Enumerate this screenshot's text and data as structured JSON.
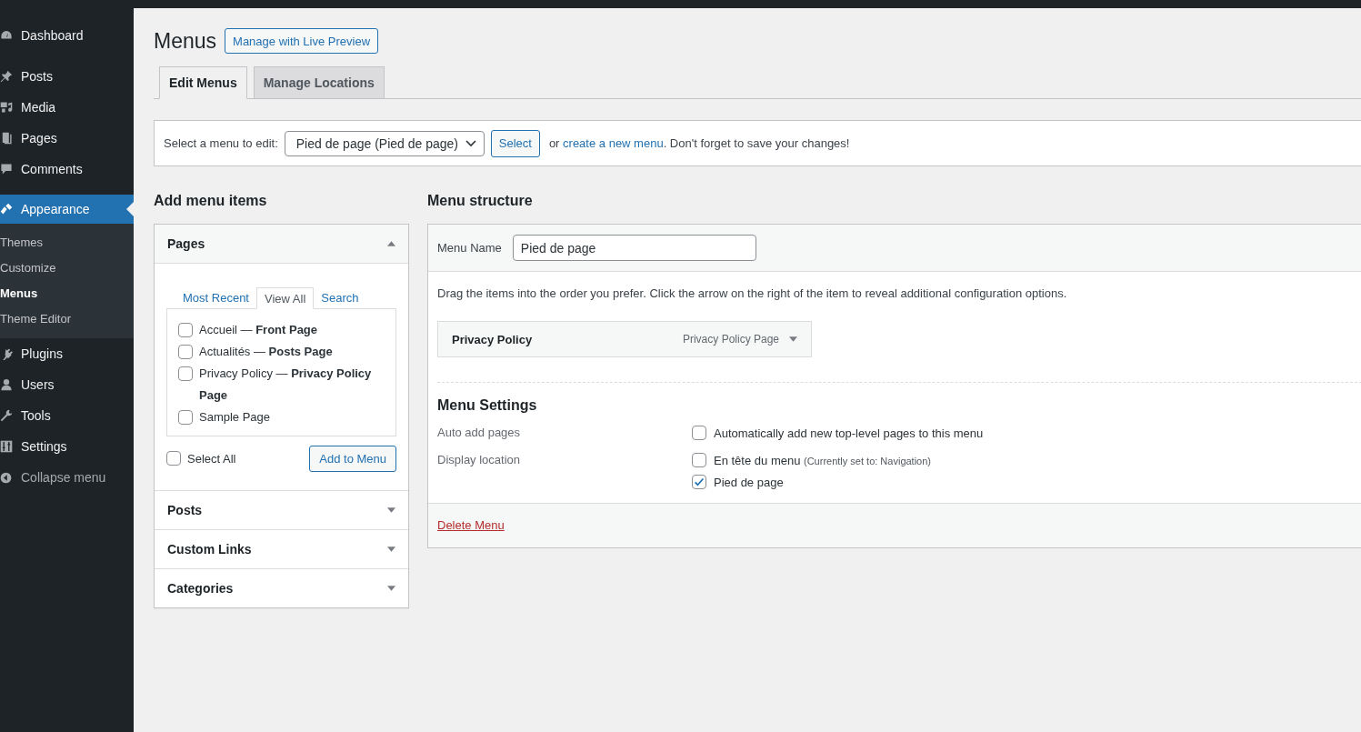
{
  "sidebar": {
    "groups": [
      [
        {
          "label": "Dashboard",
          "selected": false
        }
      ],
      [
        {
          "label": "Posts",
          "selected": false
        },
        {
          "label": "Media",
          "selected": false
        },
        {
          "label": "Pages",
          "selected": false
        },
        {
          "label": "Comments",
          "selected": false
        }
      ],
      [
        {
          "label": "Appearance",
          "selected": true,
          "children": [
            {
              "label": "Themes",
              "selected": false
            },
            {
              "label": "Customize",
              "selected": false
            },
            {
              "label": "Menus",
              "selected": true
            },
            {
              "label": "Theme Editor",
              "selected": false
            }
          ]
        },
        {
          "label": "Plugins",
          "selected": false
        },
        {
          "label": "Users",
          "selected": false
        },
        {
          "label": "Tools",
          "selected": false
        },
        {
          "label": "Settings",
          "selected": false
        }
      ]
    ],
    "collapse_label": "Collapse menu"
  },
  "page": {
    "title": "Menus",
    "live_preview_button": "Manage with Live Preview",
    "tabs": [
      {
        "label": "Edit Menus",
        "selected": true
      },
      {
        "label": "Manage Locations",
        "selected": false
      }
    ]
  },
  "menu_select": {
    "label": "Select a menu to edit:",
    "value": "Pied de page (Pied de page)",
    "button": "Select",
    "hint_before": "or ",
    "hint_link": "create a new menu",
    "hint_after": ". Don't forget to save your changes!"
  },
  "add_items": {
    "heading": "Add menu items",
    "sections": [
      {
        "title": "Pages",
        "expanded": true,
        "tabs": [
          {
            "label": "Most Recent",
            "selected": false
          },
          {
            "label": "View All",
            "selected": true
          },
          {
            "label": "Search",
            "selected": false
          }
        ],
        "items": [
          {
            "label": "Accueil — **Front Page**",
            "checked": false
          },
          {
            "label": "Actualités — **Posts Page**",
            "checked": false
          },
          {
            "label": "Privacy Policy — **Privacy Policy Page**",
            "checked": false
          },
          {
            "label": "Sample Page",
            "checked": false
          }
        ],
        "select_all": {
          "label": "Select All",
          "checked": false
        },
        "add_button": "Add to Menu"
      },
      {
        "title": "Posts",
        "expanded": false
      },
      {
        "title": "Custom Links",
        "expanded": false
      },
      {
        "title": "Categories",
        "expanded": false
      }
    ]
  },
  "structure": {
    "heading": "Menu structure",
    "name_label": "Menu Name",
    "name_value": "Pied de page",
    "instructions": "Drag the items into the order you prefer. Click the arrow on the right of the item to reveal additional configuration options.",
    "items": [
      {
        "title": "Privacy Policy",
        "type": "Privacy Policy Page"
      }
    ],
    "settings_heading": "Menu Settings",
    "settings": [
      {
        "label": "Auto add pages",
        "options": [
          {
            "label": "Automatically add new top-level pages to this menu",
            "checked": false
          }
        ]
      },
      {
        "label": "Display location",
        "options": [
          {
            "label": "En tête du menu",
            "note": "(Currently set to: Navigation)",
            "checked": false
          },
          {
            "label": "Pied de page",
            "checked": true
          }
        ]
      }
    ],
    "delete_link": "Delete Menu"
  }
}
